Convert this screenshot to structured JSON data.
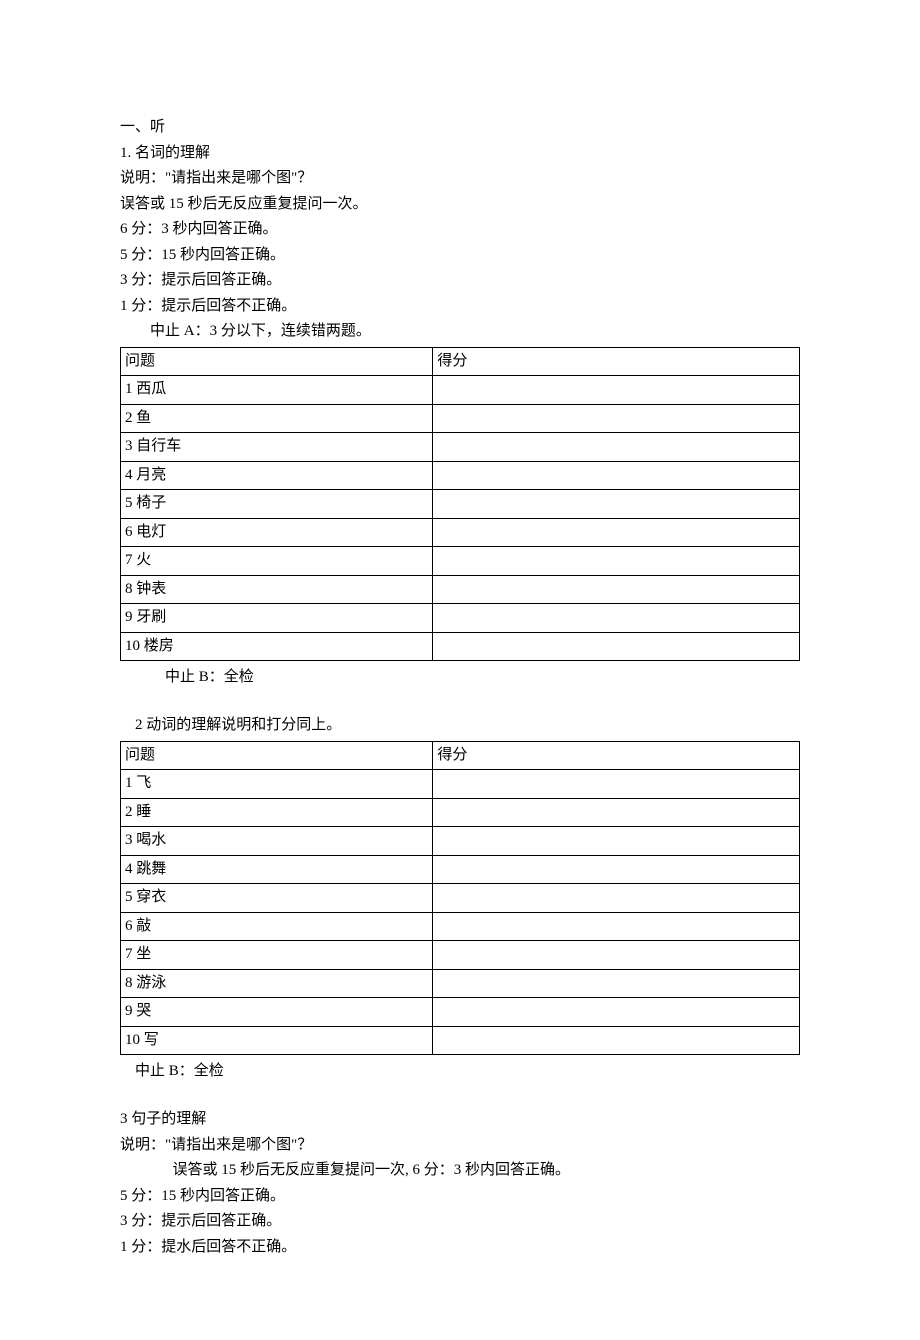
{
  "section1": {
    "heading": "一、听",
    "sub1_title": "1. 名词的理解",
    "instruction": "说明：\"请指出来是哪个图\"？",
    "repeat_rule": "误答或 15 秒后无反应重复提问一次。",
    "score6": "6 分：3 秒内回答正确。",
    "score5": "5 分：15 秒内回答正确。",
    "score3": "3 分：提示后回答正确。",
    "score1": "1 分：提示后回答不正确。",
    "stop_a": "中止 A：3 分以下，连续错两题。",
    "table1": {
      "header_q": "问题",
      "header_s": "得分",
      "rows": [
        {
          "q": "1 西瓜",
          "s": ""
        },
        {
          "q": "2 鱼",
          "s": ""
        },
        {
          "q": "3 自行车",
          "s": ""
        },
        {
          "q": "4 月亮",
          "s": ""
        },
        {
          "q": "5 椅子",
          "s": ""
        },
        {
          "q": "6 电灯",
          "s": ""
        },
        {
          "q": "7 火",
          "s": ""
        },
        {
          "q": "8 钟表",
          "s": ""
        },
        {
          "q": "9 牙刷",
          "s": ""
        },
        {
          "q": "10 楼房",
          "s": ""
        }
      ]
    },
    "stop_b1": "中止 B：全检"
  },
  "section2": {
    "sub2_title": "2 动词的理解说明和打分同上。",
    "table2": {
      "header_q": "问题",
      "header_s": "得分",
      "rows": [
        {
          "q": "1 飞",
          "s": ""
        },
        {
          "q": "2 睡",
          "s": ""
        },
        {
          "q": "3 喝水",
          "s": ""
        },
        {
          "q": "4 跳舞",
          "s": ""
        },
        {
          "q": "5 穿衣",
          "s": ""
        },
        {
          "q": "6 敲",
          "s": ""
        },
        {
          "q": "7 坐",
          "s": ""
        },
        {
          "q": "8 游泳",
          "s": ""
        },
        {
          "q": "9 哭",
          "s": ""
        },
        {
          "q": "10 写",
          "s": ""
        }
      ]
    },
    "stop_b2": "中止 B：全检"
  },
  "section3": {
    "sub3_title": "3 句子的理解",
    "instruction": "说明：\"请指出来是哪个图\"？",
    "repeat_and_6": "误答或 15 秒后无反应重复提问一次, 6 分：3 秒内回答正确。",
    "score5": "5 分：15 秒内回答正确。",
    "score3": "3 分：提示后回答正确。",
    "score1": "1 分：提水后回答不正确。"
  }
}
